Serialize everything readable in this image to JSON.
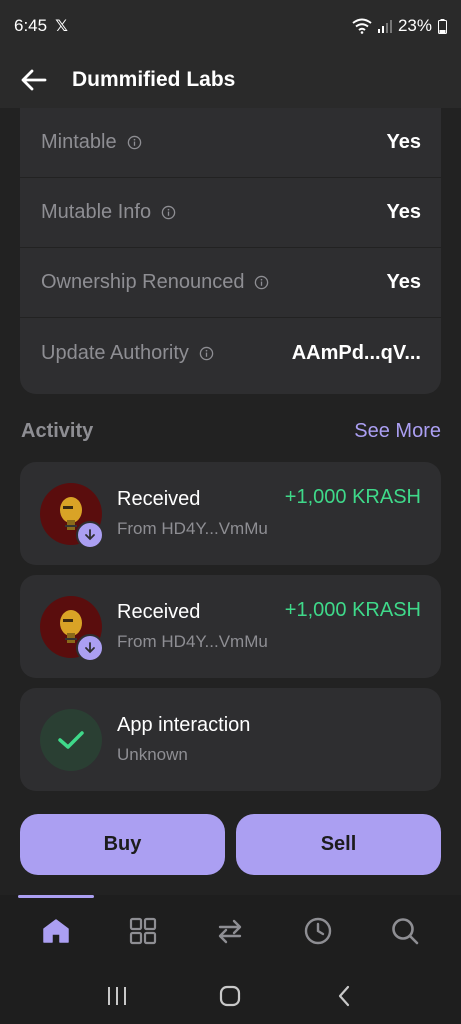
{
  "status_bar": {
    "time": "6:45",
    "battery": "23%",
    "icons": [
      "x-logo-icon",
      "wifi-icon",
      "signal-icon",
      "battery-icon"
    ]
  },
  "header": {
    "title": "Dummified Labs",
    "back_icon": "back-arrow-icon"
  },
  "token_info": {
    "rows": [
      {
        "label": "Mintable",
        "value": "Yes"
      },
      {
        "label": "Mutable Info",
        "value": "Yes"
      },
      {
        "label": "Ownership Renounced",
        "value": "Yes"
      },
      {
        "label": "Update Authority",
        "value": "AAmPd...qV..."
      }
    ]
  },
  "activity": {
    "title": "Activity",
    "see_more": "See More",
    "items": [
      {
        "type": "received",
        "title": "Received",
        "subtitle": "From HD4Y...VmMu",
        "amount": "+1,000 KRASH"
      },
      {
        "type": "received",
        "title": "Received",
        "subtitle": "From HD4Y...VmMu",
        "amount": "+1,000 KRASH"
      },
      {
        "type": "app",
        "title": "App interaction",
        "subtitle": "Unknown",
        "amount": ""
      }
    ]
  },
  "actions": {
    "buy": "Buy",
    "sell": "Sell"
  },
  "bottom_nav": {
    "items": [
      "home-icon",
      "grid-icon",
      "swap-icon",
      "history-icon",
      "search-icon"
    ],
    "active": "home-icon"
  },
  "system_nav": {
    "items": [
      "recents-icon",
      "home-button-icon",
      "back-icon"
    ]
  },
  "colors": {
    "accent": "#ab9ff2",
    "positive": "#3fd98a",
    "background": "#222222",
    "card": "#2e2e30"
  }
}
